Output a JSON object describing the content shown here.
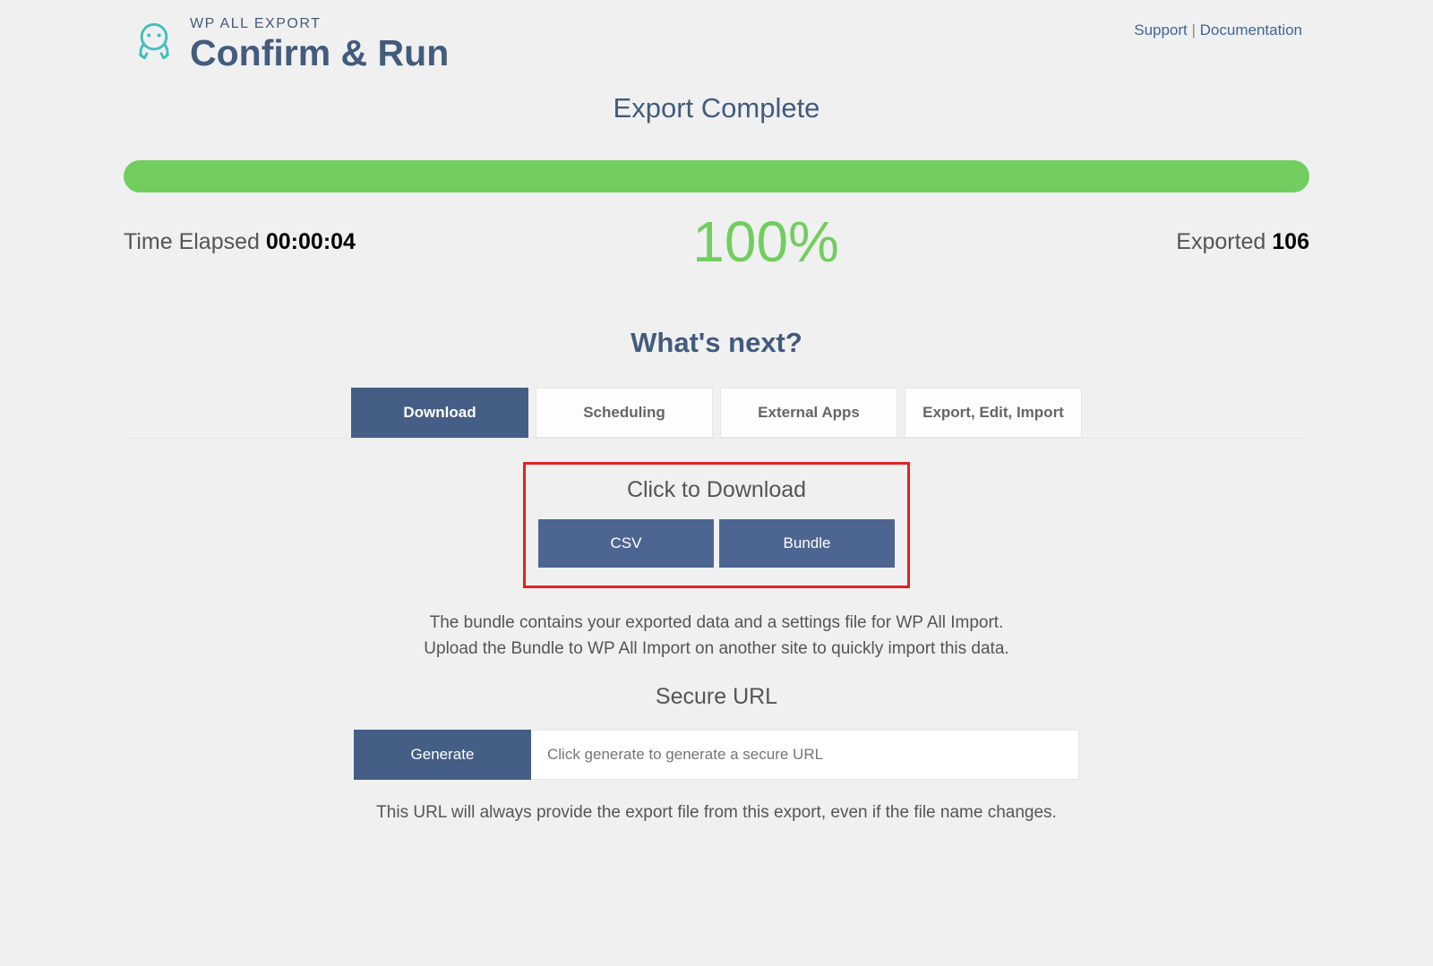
{
  "header": {
    "product_name": "WP ALL EXPORT",
    "page_title": "Confirm & Run",
    "support_label": "Support",
    "separator": " | ",
    "documentation_label": "Documentation"
  },
  "status": {
    "title": "Export Complete",
    "percent": "100%",
    "time_elapsed_label": "Time Elapsed",
    "time_elapsed_value": "00:00:04",
    "exported_label": "Exported",
    "exported_value": "106"
  },
  "next": {
    "title": "What's next?",
    "tabs": [
      {
        "label": "Download",
        "active": true
      },
      {
        "label": "Scheduling",
        "active": false
      },
      {
        "label": "External Apps",
        "active": false
      },
      {
        "label": "Export, Edit, Import",
        "active": false
      }
    ]
  },
  "download": {
    "title": "Click to Download",
    "buttons": {
      "csv": "CSV",
      "bundle": "Bundle"
    },
    "desc_line1": "The bundle contains your exported data and a settings file for WP All Import.",
    "desc_line2": "Upload the Bundle to WP All Import on another site to quickly import this data."
  },
  "secure_url": {
    "title": "Secure URL",
    "generate_label": "Generate",
    "placeholder": "Click generate to generate a secure URL",
    "note": "This URL will always provide the export file from this export, even if the file name changes."
  }
}
